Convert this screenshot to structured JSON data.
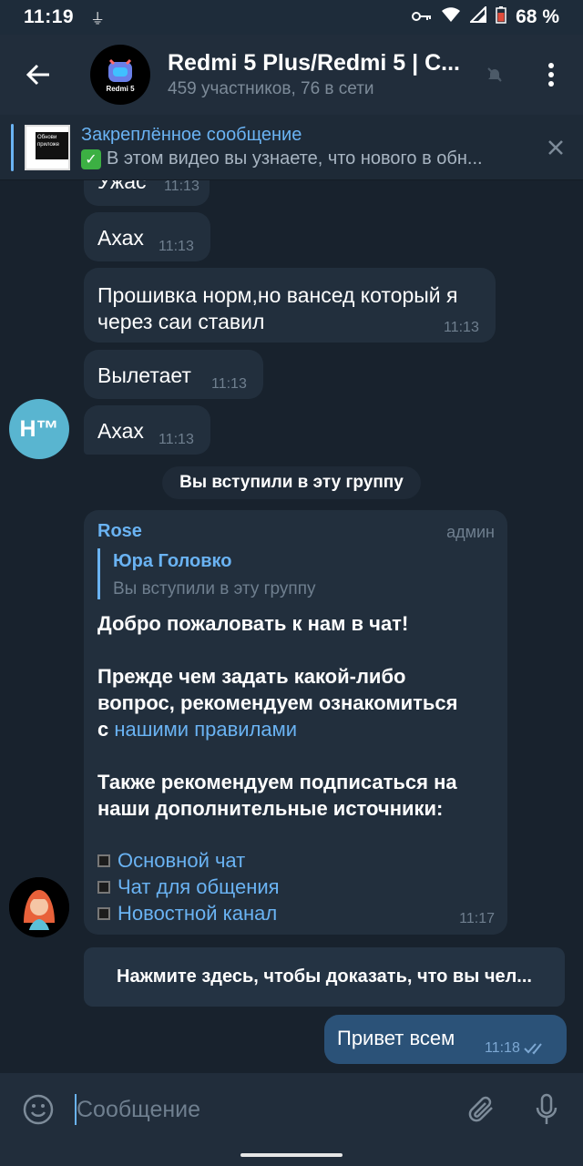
{
  "status": {
    "time": "11:19",
    "battery_pct": "68 %"
  },
  "header": {
    "title": "Redmi 5 Plus/Redmi 5 | C...",
    "subtitle": "459 участников, 76 в сети",
    "avatar_label": "Redmi 5"
  },
  "pinned": {
    "title": "Закреплённое сообщение",
    "body": "В этом видео вы узнаете, что нового в обн...",
    "thumb_text": "Обнови приложе"
  },
  "messages": [
    {
      "text": "Ужас",
      "time": "11:13"
    },
    {
      "text": "Ахах",
      "time": "11:13"
    },
    {
      "text": "Прошивка норм,но вансед который я через саи ставил",
      "time": "11:13"
    },
    {
      "text": "Вылетает",
      "time": "11:13"
    },
    {
      "text": "Ахах",
      "time": "11:13"
    }
  ],
  "sender_h": {
    "initials": "Н™"
  },
  "service": {
    "text": "Вы вступили в эту группу"
  },
  "rose": {
    "name": "Rose",
    "role": "админ",
    "reply_name": "Юра Головко",
    "reply_text": "Вы вступили в эту группу",
    "line1": "Добро пожаловать к нам в чат!",
    "line2a": "Прежде чем задать какой-либо",
    "line2b": "вопрос, рекомендуем ознакомиться",
    "line2c_prefix": "с ",
    "rules_link": "нашими правилами",
    "line3a": "Также рекомендуем подписаться на",
    "line3b": "наши дополнительные источники:",
    "links": [
      "Основной чат",
      "Чат для общения",
      "Новостной канал"
    ],
    "time": "11:17"
  },
  "cta": {
    "text": "Нажмите здесь, чтобы доказать, что вы чел..."
  },
  "outgoing": {
    "text": "Привет всем",
    "time": "11:18"
  },
  "composer": {
    "placeholder": "Сообщение"
  },
  "colors": {
    "bg": "#18222d",
    "bubble": "#222f3d",
    "accent": "#6ab3f3",
    "outgoing": "#2b5278"
  }
}
